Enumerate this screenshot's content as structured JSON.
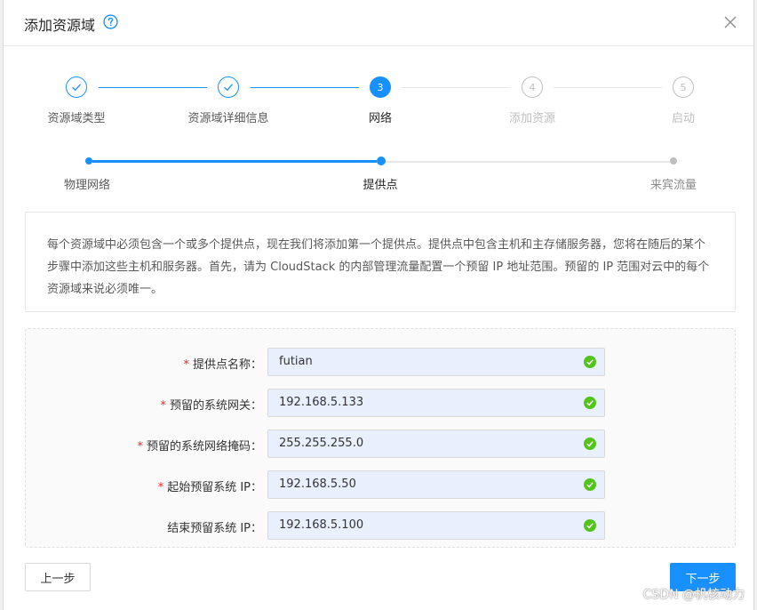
{
  "header": {
    "title": "添加资源域",
    "help_icon": "question-circle-icon",
    "close_icon": "close-icon"
  },
  "steps": [
    {
      "label": "资源域类型",
      "number": "1",
      "status": "done"
    },
    {
      "label": "资源域详细信息",
      "number": "2",
      "status": "done"
    },
    {
      "label": "网络",
      "number": "3",
      "status": "active"
    },
    {
      "label": "添加资源",
      "number": "4",
      "status": "wait"
    },
    {
      "label": "启动",
      "number": "5",
      "status": "wait"
    }
  ],
  "substeps": [
    {
      "label": "物理网络",
      "status": "done"
    },
    {
      "label": "提供点",
      "status": "active"
    },
    {
      "label": "来宾流量",
      "status": "wait"
    }
  ],
  "info": {
    "text": "每个资源域中必须包含一个或多个提供点，现在我们将添加第一个提供点。提供点中包含主机和主存储服务器，您将在随后的某个步骤中添加这些主机和服务器。首先，请为 CloudStack 的内部管理流量配置一个预留 IP 地址范围。预留的 IP 范围对云中的每个资源域来说必须唯一。"
  },
  "form": {
    "fields": [
      {
        "label": "提供点名称：",
        "value": "futian",
        "required": true
      },
      {
        "label": "预留的系统网关：",
        "value": "192.168.5.133",
        "required": true
      },
      {
        "label": "预留的系统网络掩码：",
        "value": "255.255.255.0",
        "required": true
      },
      {
        "label": "起始预留系统 IP：",
        "value": "192.168.5.50",
        "required": true
      },
      {
        "label": "结束预留系统 IP：",
        "value": "192.168.5.100",
        "required": false
      }
    ],
    "required_mark": "*"
  },
  "buttons": {
    "prev": "上一步",
    "next": "下一步"
  },
  "watermark": "CSDN @机核动力",
  "colors": {
    "primary": "#1890ff",
    "success": "#52c41a",
    "required": "#f5222d",
    "input_bg": "#e8f0fe"
  }
}
